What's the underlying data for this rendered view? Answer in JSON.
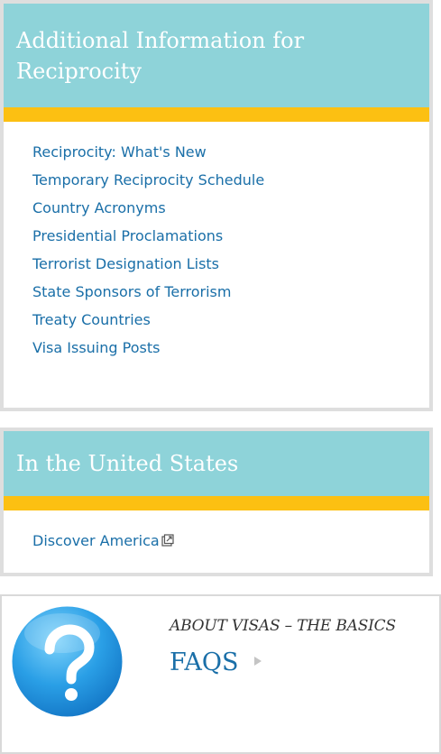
{
  "reciprocity_panel": {
    "title": "Additional Information for Reciprocity",
    "links": [
      {
        "label": "Reciprocity: What's New"
      },
      {
        "label": "Temporary Reciprocity Schedule"
      },
      {
        "label": "Country Acronyms"
      },
      {
        "label": "Presidential Proclamations"
      },
      {
        "label": "Terrorist Designation Lists"
      },
      {
        "label": "State Sponsors of Terrorism"
      },
      {
        "label": "Treaty Countries"
      },
      {
        "label": "Visa Issuing Posts"
      }
    ]
  },
  "us_panel": {
    "title": "In the United States",
    "links": [
      {
        "label": "Discover America",
        "icon": "external-link-icon"
      }
    ]
  },
  "faq_promo": {
    "kicker": "ABOUT VISAS – THE BASICS",
    "title": "FAQS",
    "icon": "question-mark-icon",
    "arrow_icon": "chevron-right-icon"
  },
  "colors": {
    "header_bg": "#8ed3d9",
    "accent_rule": "#fcc012",
    "link": "#1a6fa8",
    "panel_border": "#dedede"
  }
}
